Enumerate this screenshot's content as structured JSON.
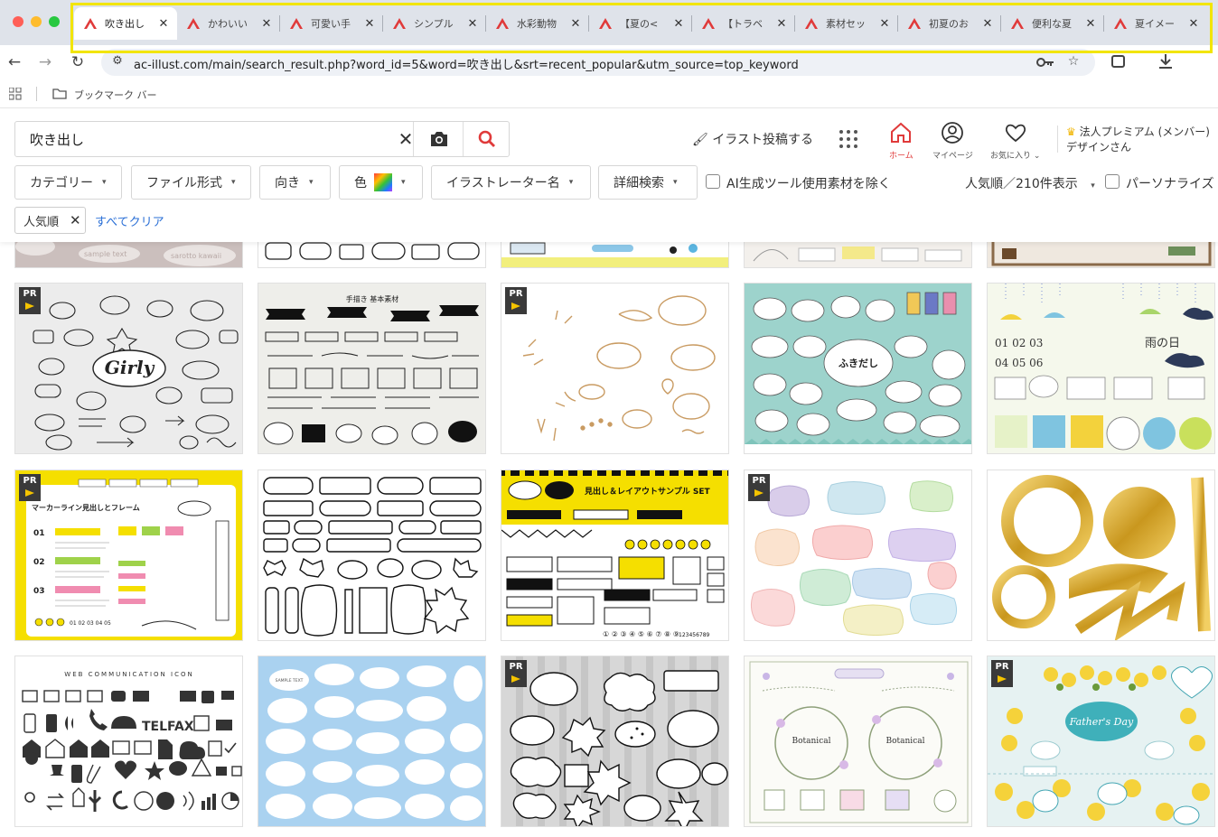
{
  "browser": {
    "tabs": [
      {
        "title": "吹き出し",
        "active": true
      },
      {
        "title": "かわいい",
        "active": false
      },
      {
        "title": "可愛い手",
        "active": false
      },
      {
        "title": "シンプル",
        "active": false
      },
      {
        "title": "水彩動物",
        "active": false
      },
      {
        "title": "【夏の<",
        "active": false
      },
      {
        "title": "【トラベ",
        "active": false
      },
      {
        "title": "素材セッ",
        "active": false
      },
      {
        "title": "初夏のお",
        "active": false
      },
      {
        "title": "便利な夏",
        "active": false
      },
      {
        "title": "夏イメー",
        "active": false
      }
    ],
    "url": "ac-illust.com/main/search_result.php?word_id=5&word=吹き出し&srt=recent_popular&utm_source=top_keyword",
    "bookmark_bar_label": "ブックマーク バー",
    "accent": "#e03a3a"
  },
  "site": {
    "search": {
      "value": "吹き出し",
      "placeholder": ""
    },
    "post_illust_label": "イラスト投稿する",
    "nav": {
      "home_label": "ホーム",
      "mypage_label": "マイページ",
      "favorites_label": "お気に入り"
    },
    "premium": {
      "line1": "法人プレミアム (メンバー)",
      "line2": "デザインさん"
    },
    "filters": {
      "category": "カテゴリー",
      "file_format": "ファイル形式",
      "orientation": "向き",
      "color": "色",
      "illustrator": "イラストレーター名",
      "advanced": "詳細検索"
    },
    "exclude_ai_label": "AI生成ツール使用素材を除く",
    "sort_label": "人気順／210件表示",
    "personalize_label": "パーソナライズ",
    "active_chip": "人気順",
    "clear_all_label": "すべてクリア"
  },
  "results": {
    "pr_label": "PR",
    "partial_row": [
      {
        "text_a": "sample text",
        "text_b": "sarotto kawaii"
      },
      {
        "text_a": "",
        "text_b": ""
      },
      {
        "text_a": "",
        "text_b": ""
      },
      {
        "text_a": "",
        "text_b": ""
      },
      {
        "text_a": "",
        "text_b": ""
      }
    ],
    "rows": [
      [
        {
          "pr": true,
          "title_text": "Girly"
        },
        {
          "pr": false,
          "title_text": "手描き 基本素材"
        },
        {
          "pr": true,
          "title_text": ""
        },
        {
          "pr": false,
          "title_text": "ふきだし"
        },
        {
          "pr": false,
          "title_text": "雨の日"
        }
      ],
      [
        {
          "pr": true,
          "title_text": "マーカーライン見出しとフレーム"
        },
        {
          "pr": false,
          "title_text": ""
        },
        {
          "pr": false,
          "title_text": "見出し＆レイアウトサンプル SET"
        },
        {
          "pr": true,
          "title_text": ""
        },
        {
          "pr": false,
          "title_text": ""
        }
      ],
      [
        {
          "pr": false,
          "title_text": "WEB COMMUNICATION ICON"
        },
        {
          "pr": false,
          "title_text": "SAMPLE TEXT"
        },
        {
          "pr": true,
          "title_text": ""
        },
        {
          "pr": false,
          "title_text": "Botanical"
        },
        {
          "pr": true,
          "title_text": "Father's Day"
        }
      ]
    ]
  }
}
